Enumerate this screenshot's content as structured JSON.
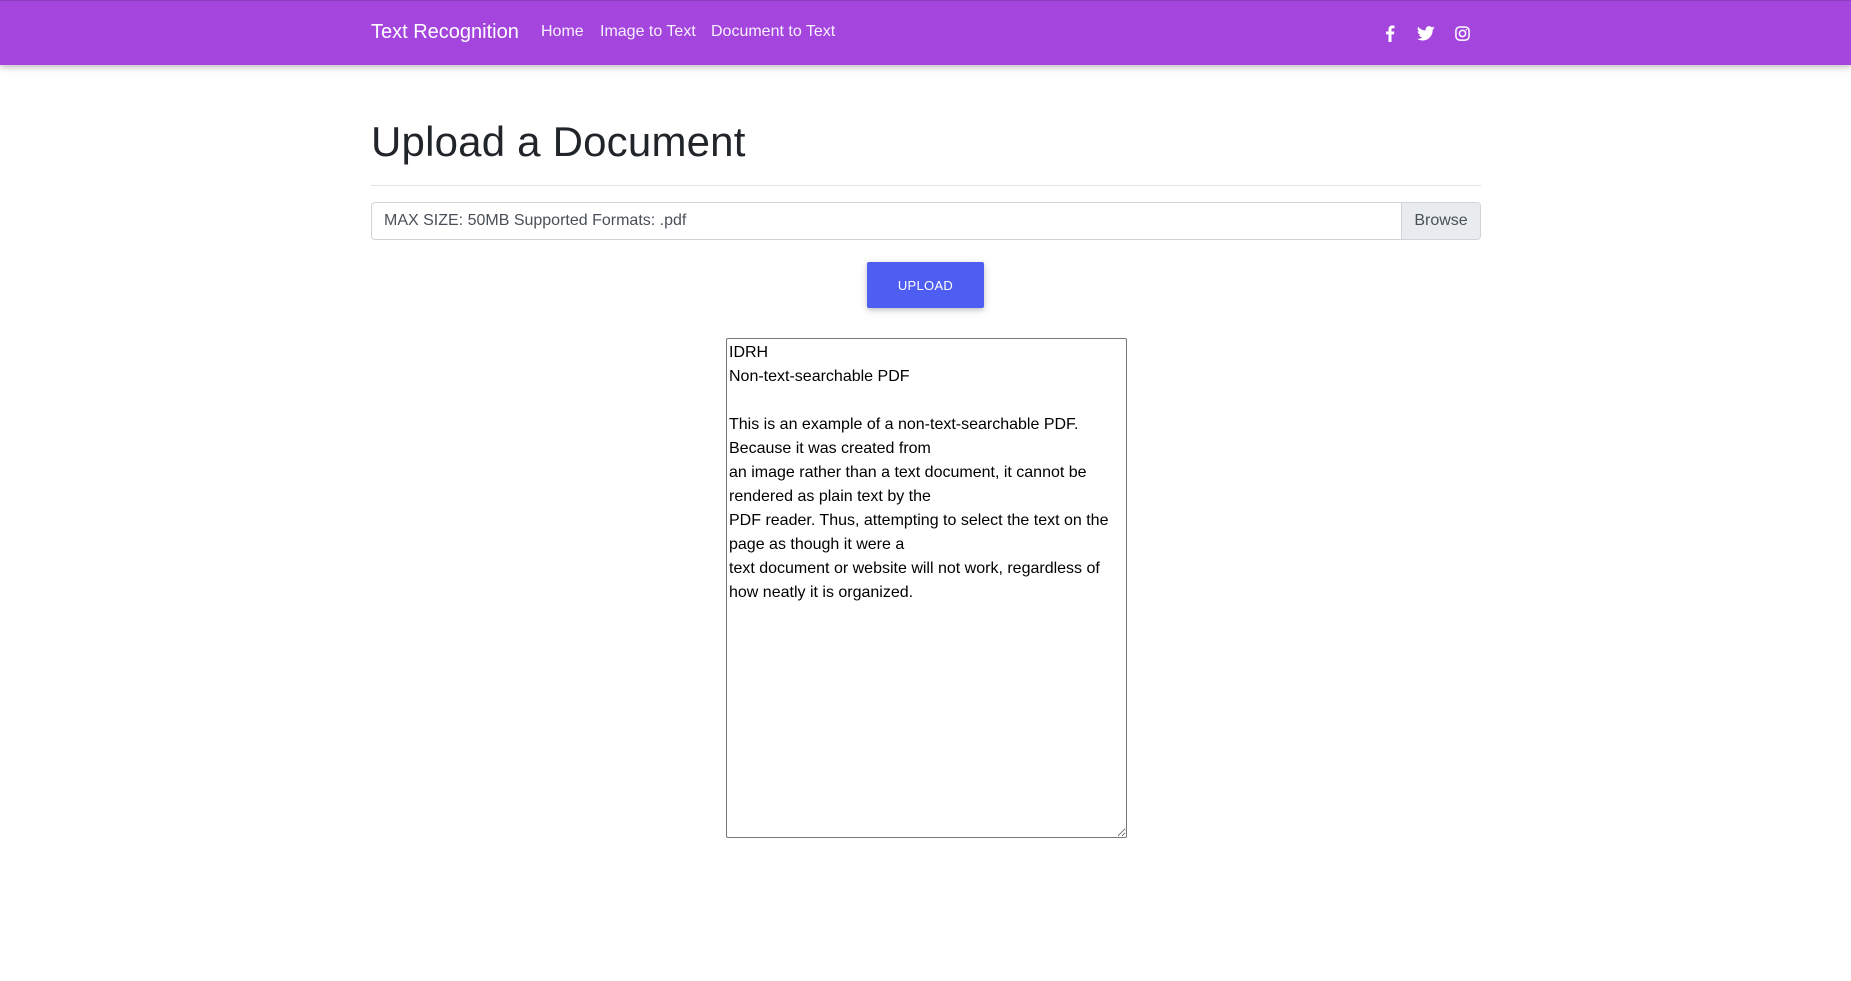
{
  "colors": {
    "navbar_bg": "#a445de",
    "upload_button_bg": "#4f5ef2"
  },
  "navbar": {
    "brand": "Text Recognition",
    "links": [
      {
        "label": "Home"
      },
      {
        "label": "Image to Text"
      },
      {
        "label": "Document to Text"
      }
    ],
    "social_icons": [
      "facebook-icon",
      "twitter-icon",
      "instagram-icon"
    ]
  },
  "main": {
    "title": "Upload a Document",
    "file_input": {
      "label": "MAX SIZE: 50MB Supported Formats: .pdf",
      "browse_label": "Browse"
    },
    "upload_button": "UPLOAD",
    "result_text": "IDRH\nNon-text-searchable PDF\n\nThis is an example of a non-text-searchable PDF.\nBecause it was created from\nan image rather than a text document, it cannot be\nrendered as plain text by the\nPDF reader. Thus, attempting to select the text on the\npage as though it were a\ntext document or website will not work, regardless of\nhow neatly it is organized."
  }
}
